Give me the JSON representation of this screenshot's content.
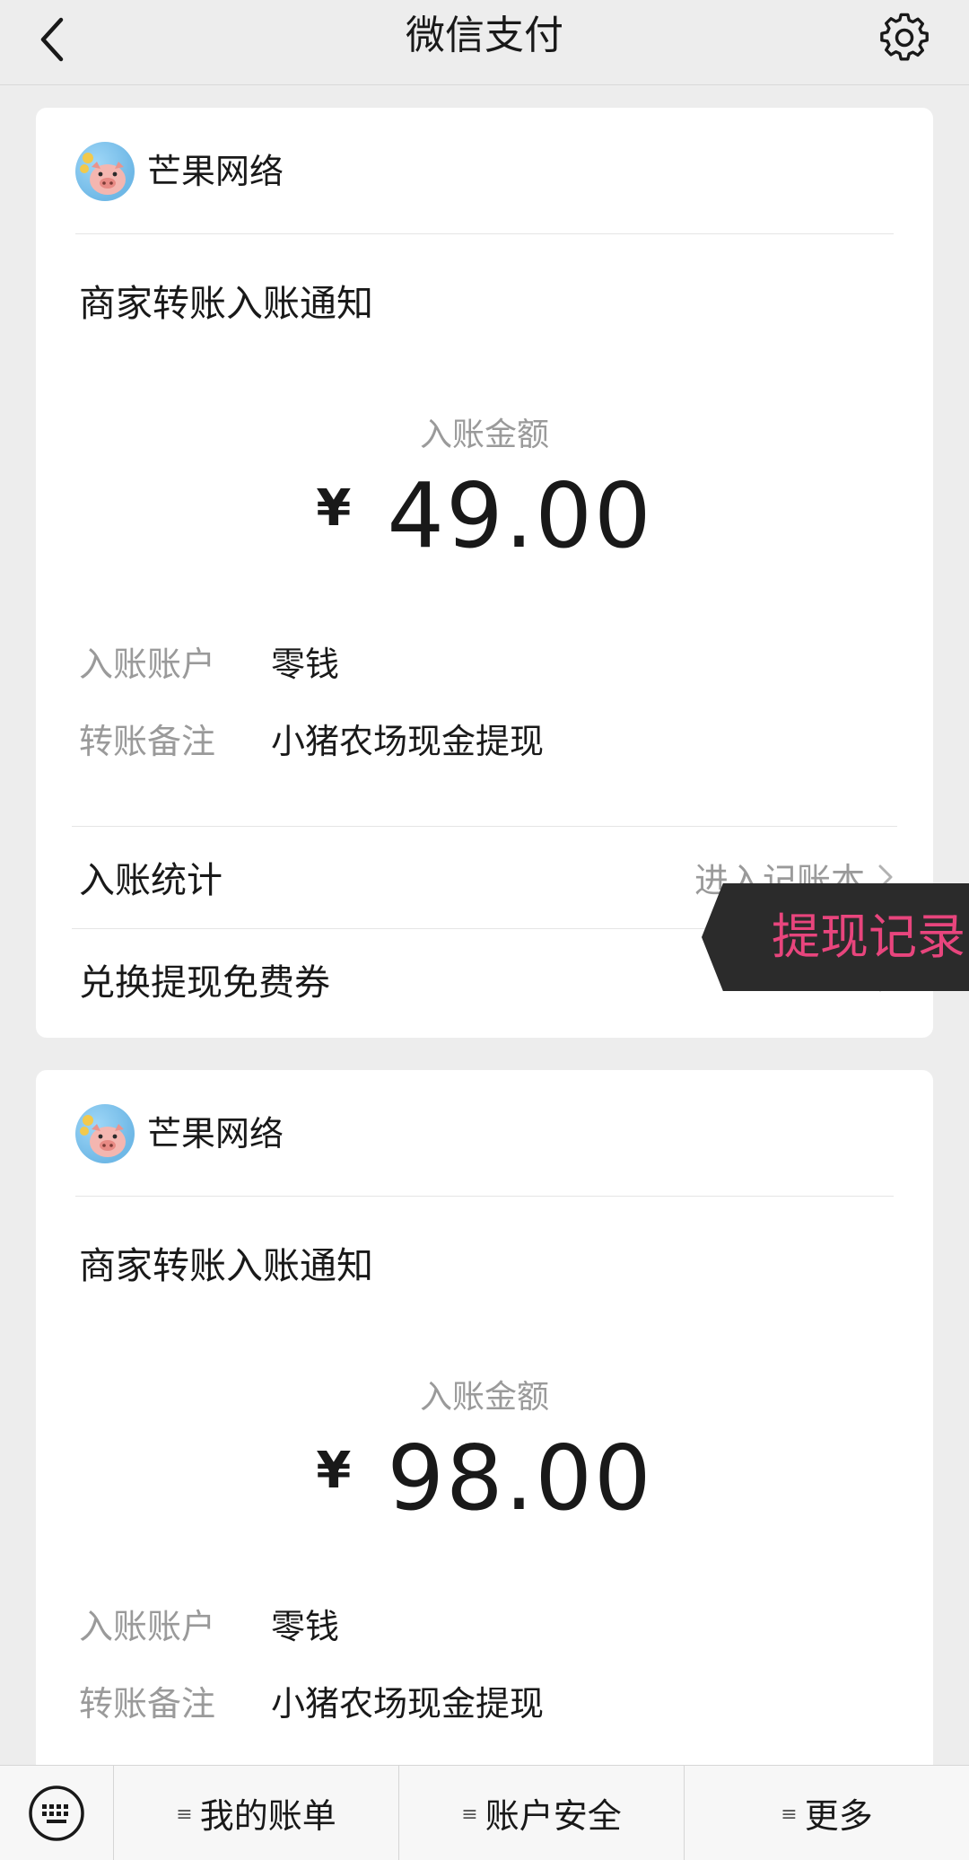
{
  "nav": {
    "title": "微信支付",
    "back_icon": "chevron-left-icon",
    "settings_icon": "gear-icon"
  },
  "cards": [
    {
      "merchant": "芒果网络",
      "title": "商家转账入账通知",
      "amount_label": "入账金额",
      "currency": "¥",
      "amount": "49.00",
      "account_key": "入账账户",
      "account_value": "零钱",
      "note_key": "转账备注",
      "note_value": "小猪农场现金提现",
      "stats_label": "入账统计",
      "stats_link": "进入记账本",
      "coupon_label": "兑换提现免费券"
    },
    {
      "merchant": "芒果网络",
      "title": "商家转账入账通知",
      "amount_label": "入账金额",
      "currency": "¥",
      "amount": "98.00",
      "account_key": "入账账户",
      "account_value": "零钱",
      "note_key": "转账备注",
      "note_value": "小猪农场现金提现"
    }
  ],
  "overlay": {
    "text": "提现记录"
  },
  "tabbar": {
    "keyboard_icon": "keyboard-icon",
    "tabs": [
      "我的账单",
      "账户安全",
      "更多"
    ]
  },
  "colors": {
    "overlay_text": "#e8457d",
    "secondary_text": "#9a9a9a",
    "background": "#ededed"
  }
}
